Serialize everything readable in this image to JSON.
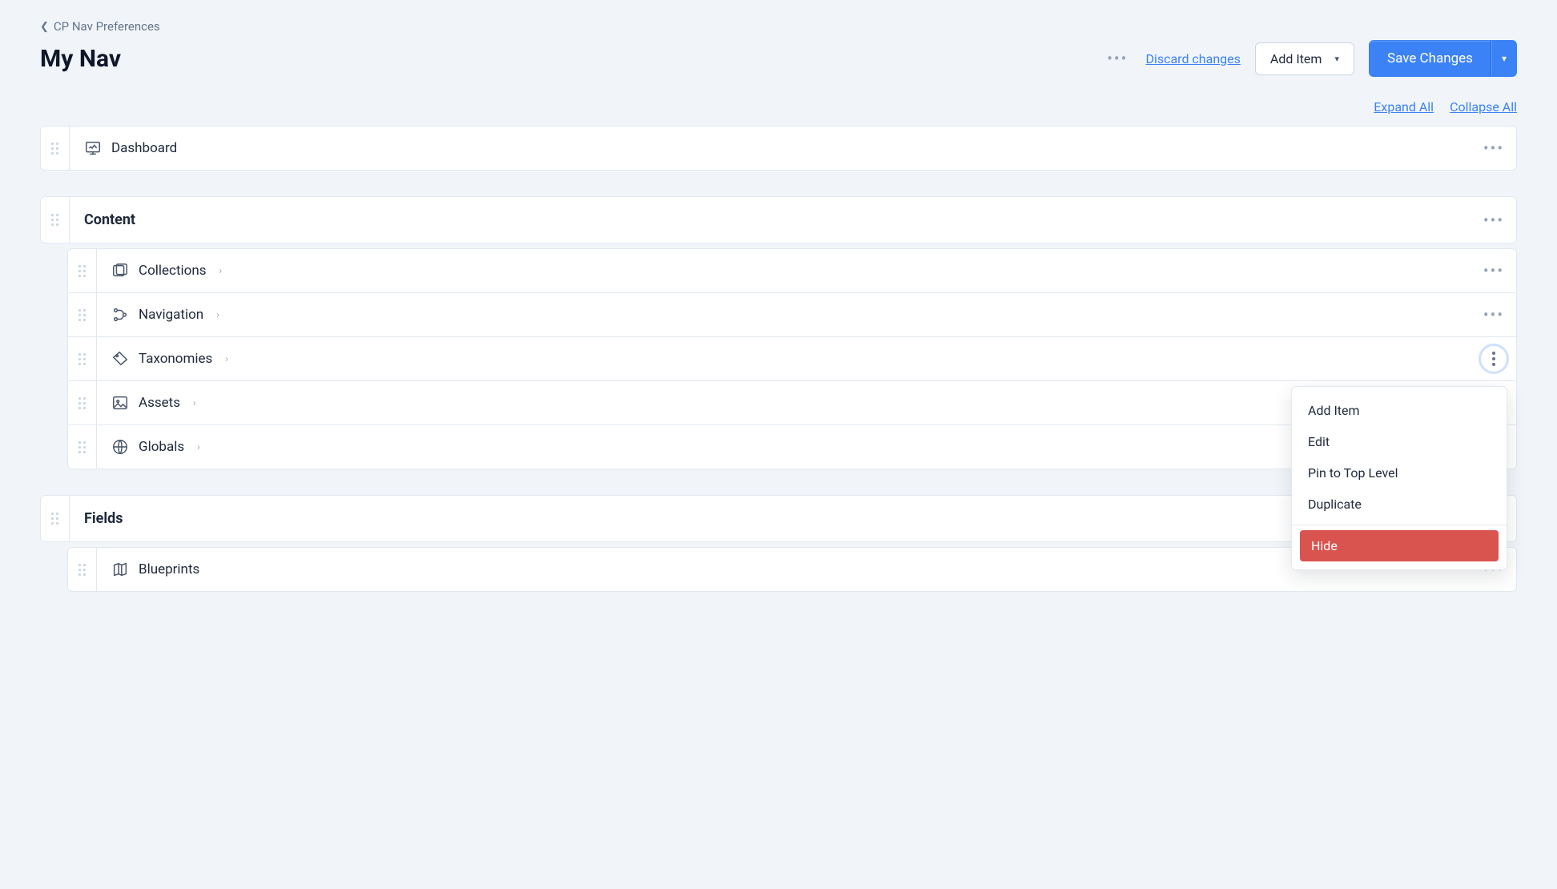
{
  "breadcrumb": {
    "back_label": "CP Nav Preferences"
  },
  "header": {
    "title": "My Nav",
    "discard_label": "Discard changes",
    "add_item_label": "Add Item",
    "save_label": "Save Changes"
  },
  "collapse": {
    "expand_all": "Expand All",
    "collapse_all": "Collapse All"
  },
  "section_dashboard": {
    "label": "Dashboard"
  },
  "section_content": {
    "label": "Content",
    "items": {
      "collections": "Collections",
      "navigation": "Navigation",
      "taxonomies": "Taxonomies",
      "assets": "Assets",
      "globals": "Globals"
    }
  },
  "section_fields": {
    "label": "Fields",
    "items": {
      "blueprints": "Blueprints"
    }
  },
  "context_menu": {
    "add_item": "Add Item",
    "edit": "Edit",
    "pin_top": "Pin to Top Level",
    "duplicate": "Duplicate",
    "hide": "Hide"
  }
}
